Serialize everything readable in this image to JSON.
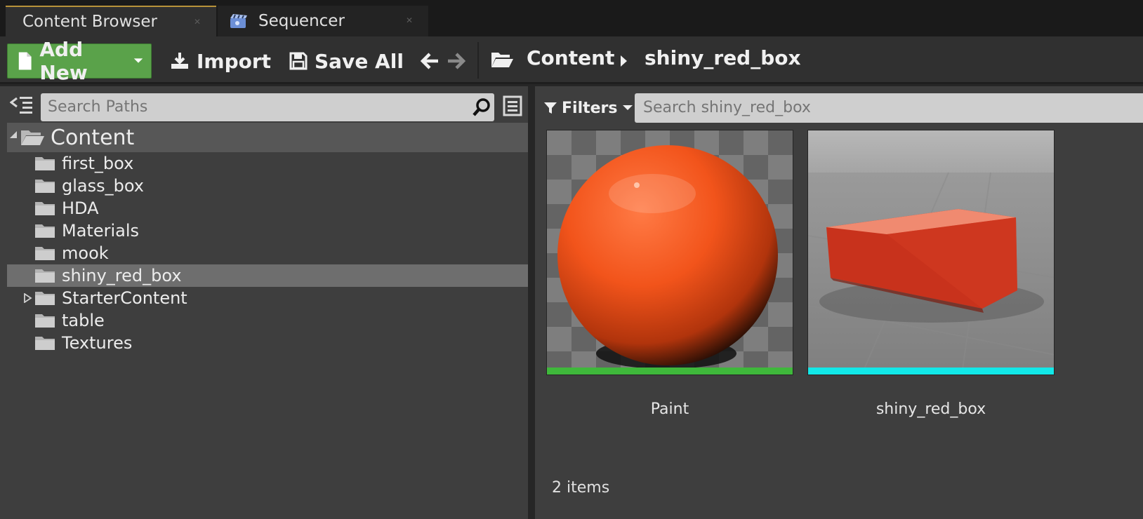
{
  "tabs": [
    {
      "label": "Content Browser",
      "close": "✕"
    },
    {
      "label": "Sequencer",
      "close": "✕"
    }
  ],
  "toolbar": {
    "add_new_label": "Add New",
    "import_label": "Import",
    "save_all_label": "Save All"
  },
  "breadcrumb": [
    "Content",
    "shiny_red_box"
  ],
  "sources": {
    "search_placeholder": "Search Paths",
    "root_label": "Content",
    "folders": [
      "first_box",
      "glass_box",
      "HDA",
      "Materials",
      "mook",
      "shiny_red_box",
      "StarterContent",
      "table",
      "Textures"
    ],
    "selected_folder": "shiny_red_box"
  },
  "assets_panel": {
    "filters_label": "Filters",
    "search_placeholder": "Search shiny_red_box",
    "assets": [
      {
        "name": "Paint",
        "type_color": "#3fb83b"
      },
      {
        "name": "shiny_red_box",
        "type_color": "#12e8e8"
      }
    ],
    "item_count": "2 items"
  },
  "colors": {
    "add_new_green": "#5aa24a",
    "active_tab_accent": "#b8923a"
  },
  "icons": [
    "content-browser-tab",
    "sequencer-icon",
    "add-new-file-icon",
    "import-icon",
    "save-icon",
    "back-arrow-icon",
    "forward-arrow-icon",
    "folder-open-icon",
    "breadcrumb-arrow-icon",
    "sources-toggle-icon",
    "search-icon",
    "list-view-icon",
    "folder-icon",
    "filter-icon",
    "dropdown-arrow-icon"
  ]
}
